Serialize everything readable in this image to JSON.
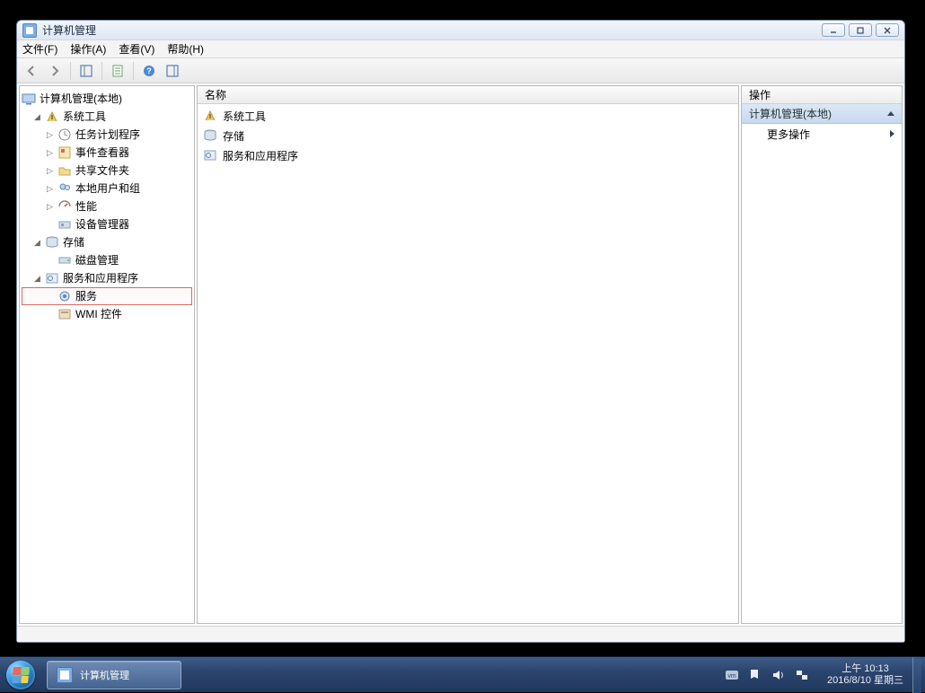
{
  "window": {
    "title": "计算机管理"
  },
  "menu": {
    "file": "文件(F)",
    "action": "操作(A)",
    "view": "查看(V)",
    "help": "帮助(H)"
  },
  "tree": {
    "root_label": "计算机管理(本地)",
    "nodes": {
      "system_tools": "系统工具",
      "task_scheduler": "任务计划程序",
      "event_viewer": "事件查看器",
      "shared_folders": "共享文件夹",
      "local_users": "本地用户和组",
      "performance": "性能",
      "device_manager": "设备管理器",
      "storage": "存储",
      "disk_management": "磁盘管理",
      "services_apps": "服务和应用程序",
      "services": "服务",
      "wmi_control": "WMI 控件"
    }
  },
  "list": {
    "header_name": "名称",
    "rows": {
      "system_tools": "系统工具",
      "storage": "存储",
      "services_apps": "服务和应用程序"
    }
  },
  "actions": {
    "header": "操作",
    "group_title": "计算机管理(本地)",
    "more_actions": "更多操作"
  },
  "taskbar": {
    "task_label": "计算机管理",
    "time": "上午 10:13",
    "date": "2016/8/10 星期三"
  }
}
